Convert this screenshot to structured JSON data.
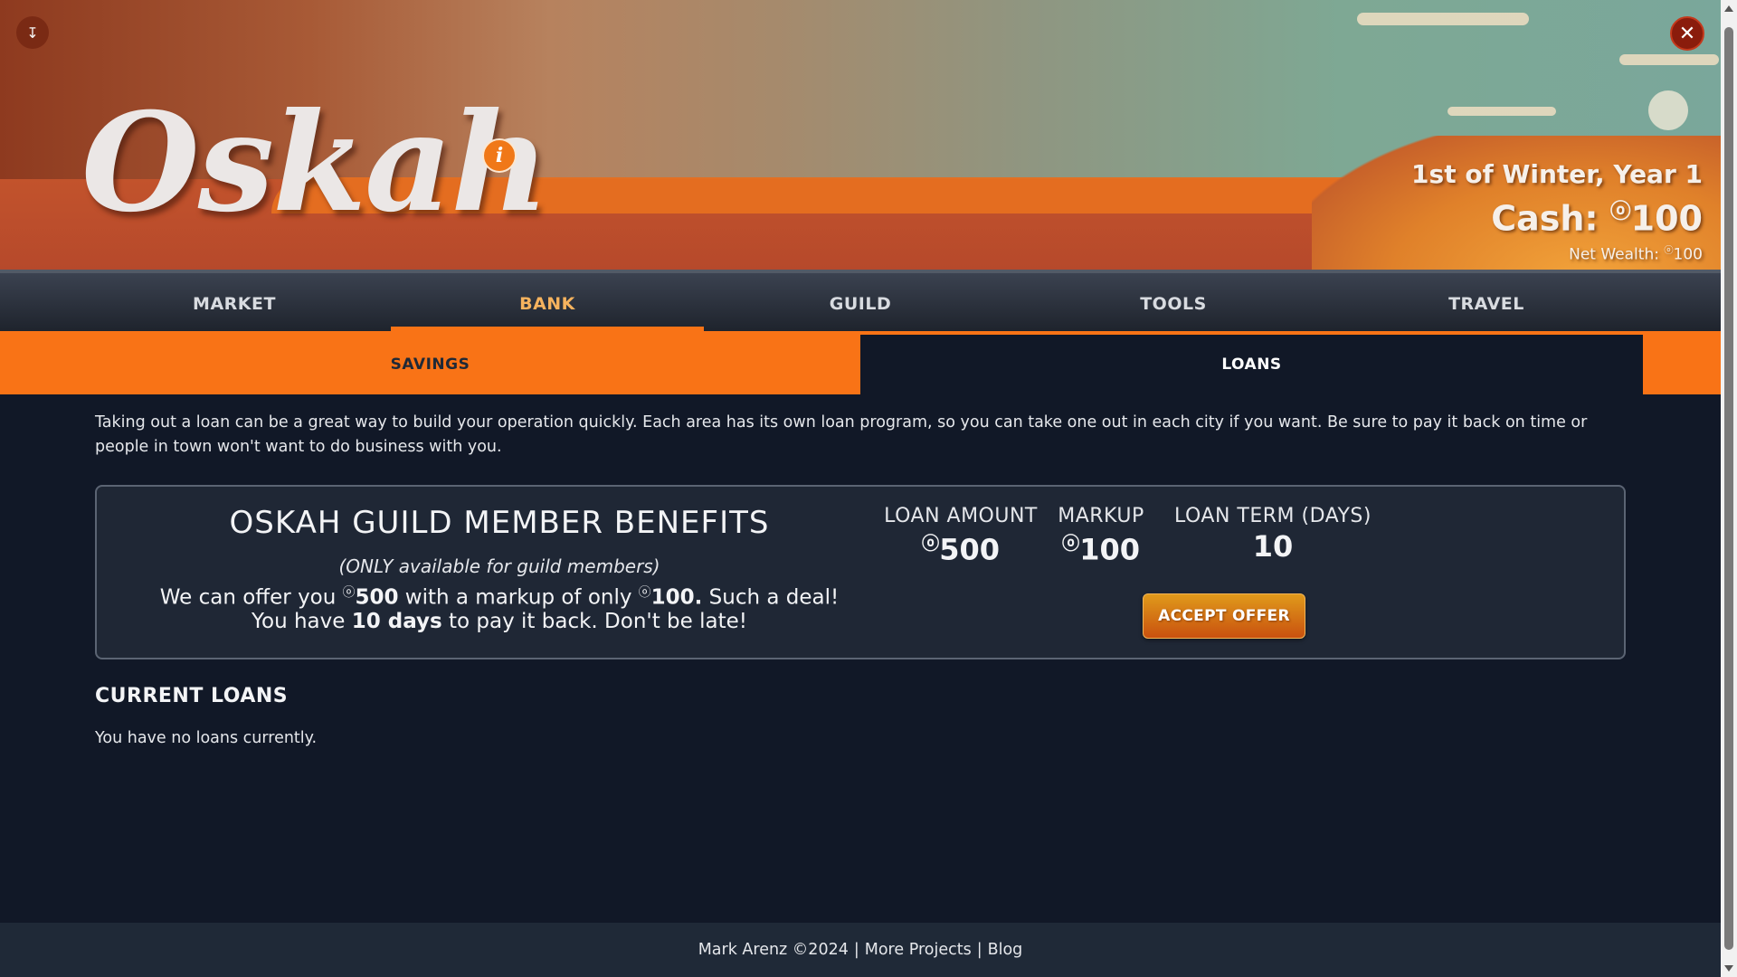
{
  "header": {
    "logo_text": "Oskah",
    "info_icon_glyph": "i",
    "download_icon": "download-icon",
    "close_icon": "close-icon",
    "date": "1st of Winter, Year 1",
    "cash_label": "Cash:",
    "coin_symbol": "ⓞ",
    "cash_value": "100",
    "net_wealth_label": "Net Wealth:",
    "net_wealth_value": "100"
  },
  "nav": {
    "tabs": [
      {
        "label": "MARKET"
      },
      {
        "label": "BANK"
      },
      {
        "label": "GUILD"
      },
      {
        "label": "TOOLS"
      },
      {
        "label": "TRAVEL"
      }
    ],
    "active_tab": "BANK"
  },
  "subnav": {
    "savings_label": "SAVINGS",
    "loans_label": "LOANS",
    "active": "LOANS"
  },
  "loans": {
    "intro": "Taking out a loan can be a great way to build your operation quickly. Each area has its own loan program, so you can take one out in each city if you want. Be sure to pay it back on time or people in town won't want to do business with you.",
    "offer": {
      "title": "OSKAH GUILD MEMBER BENEFITS",
      "subtitle": "(ONLY available for guild members)",
      "line1_pre": "We can offer you",
      "line1_amount": "500",
      "line1_mid": "with a markup of only",
      "line1_markup": "100.",
      "line1_post": "Such a deal!",
      "line2_pre": "You have",
      "line2_days": "10 days",
      "line2_post": "to pay it back. Don't be late!",
      "amount_label": "LOAN AMOUNT",
      "amount_value": "500",
      "markup_label": "MARKUP",
      "markup_value": "100",
      "term_label": "LOAN TERM (DAYS)",
      "term_value": "10",
      "accept_label": "ACCEPT OFFER"
    },
    "current_title": "CURRENT LOANS",
    "current_empty": "You have no loans currently."
  },
  "footer": {
    "copyright": "Mark Arenz ©2024",
    "separator": "|",
    "more_projects": "More Projects",
    "blog": "Blog"
  },
  "colors": {
    "accent": "#f97316",
    "active_tab_text": "#f6b35e",
    "background": "#111827",
    "panel": "#1f2735"
  }
}
